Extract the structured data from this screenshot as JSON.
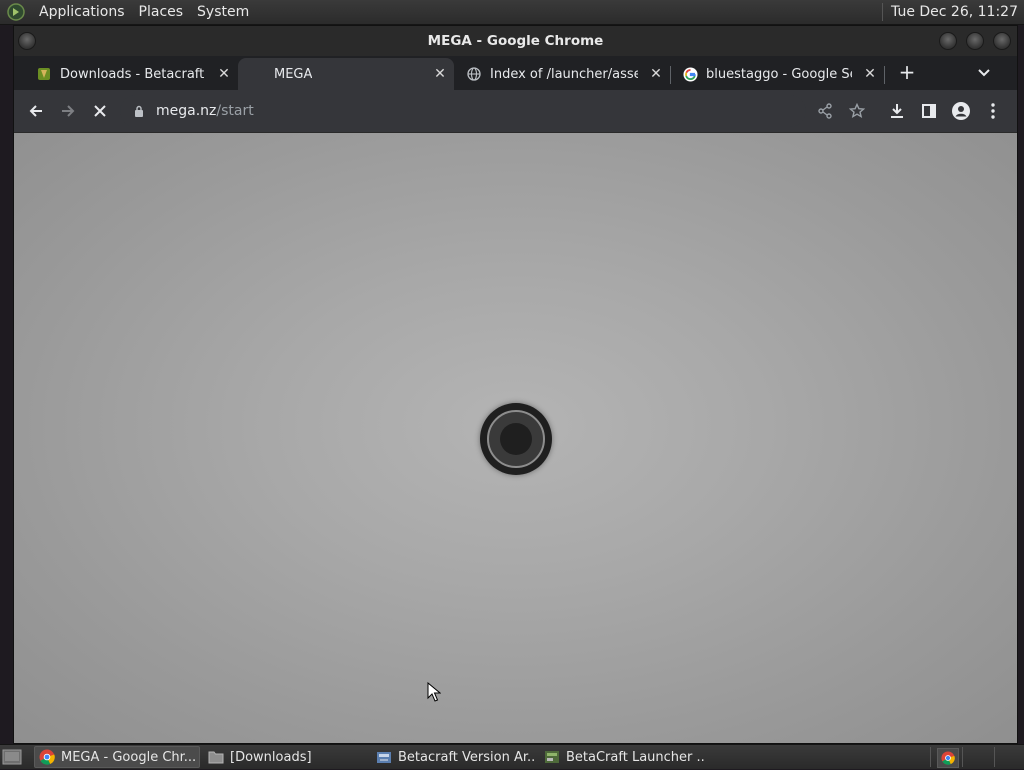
{
  "top_panel": {
    "menus": [
      "Applications",
      "Places",
      "System"
    ],
    "clock": "Tue Dec 26, 11:27"
  },
  "window": {
    "title": "MEGA - Google Chrome"
  },
  "tabs": [
    {
      "label": "Downloads - Betacraft",
      "favicon": "betacraft-icon",
      "active": false
    },
    {
      "label": "MEGA",
      "favicon": "none",
      "active": true
    },
    {
      "label": "Index of /launcher/assets/",
      "favicon": "globe-icon",
      "active": false
    },
    {
      "label": "bluestaggo - Google Search",
      "favicon": "google-icon",
      "active": false
    }
  ],
  "toolbar": {
    "url_host": "mega.nz",
    "url_path": "/start"
  },
  "taskbar": {
    "tasks": [
      {
        "label": "MEGA - Google Chr...",
        "icon": "chrome-icon",
        "active": true
      },
      {
        "label": "[Downloads]",
        "icon": "folder-icon",
        "active": false
      },
      {
        "label": "Betacraft Version Ar...",
        "icon": "java-icon",
        "active": false
      },
      {
        "label": "BetaCraft Launcher ...",
        "icon": "betacraft-launcher-icon",
        "active": false
      }
    ]
  },
  "colors": {
    "chrome_dark": "#202124",
    "tab_active": "#35363a",
    "content_gray": "#a8a8a8"
  }
}
